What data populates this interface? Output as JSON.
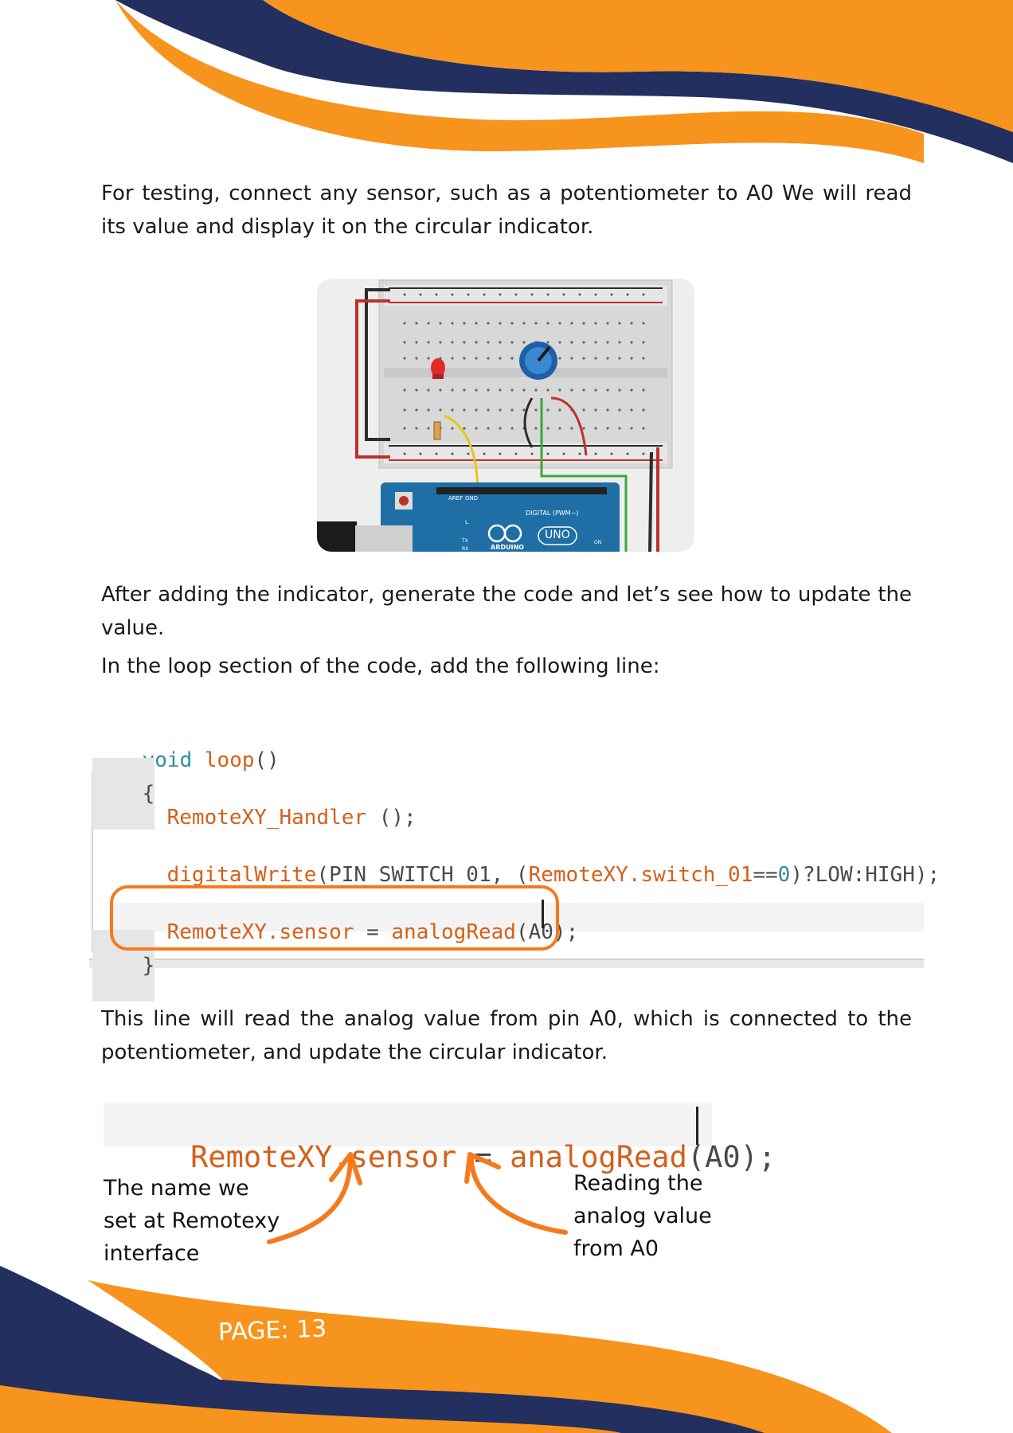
{
  "paragraphs": {
    "p1": "For testing, connect any sensor, such as a potentiometer to A0 We will read its value and display it on the circular indicator.",
    "p2": "After adding the indicator, generate the code and let’s see how to update the value.",
    "p3": "In the loop section of the code, add the following line:",
    "p4": "This line will read the analog value from pin A0, which is connected to the potentiometer, and update the circular indicator."
  },
  "circuit": {
    "board_pin_header": "DIGITAL (PWM~)",
    "board_logo": "UNO",
    "board_brand": "ARDUINO",
    "on_label": "ON",
    "tx_label": "TX",
    "rx_label": "RX",
    "l_label": "L",
    "aref": "AREF",
    "gnd": "GND"
  },
  "code": {
    "kw_void": "void",
    "fn_loop": "loop",
    "parens": "()",
    "brace_open": "{",
    "brace_close": "}",
    "handler_name": "RemoteXY_Handler",
    "handler_rest": " ();",
    "dw_name": "digitalWrite",
    "dw_open": "(PIN_SWITCH_01, (",
    "dw_obj": "RemoteXY",
    "dw_field": ".switch_01",
    "dw_eq": "==",
    "dw_zero": "0",
    "dw_tail": ")?LOW:HIGH);",
    "sensor_obj": "RemoteXY",
    "sensor_field": ".sensor",
    "sensor_eq": " = ",
    "sensor_fn": "analogRead",
    "sensor_args": "(A0);"
  },
  "annotations": {
    "left": [
      "The name we",
      "set at Remotexy",
      "interface"
    ],
    "right": [
      "Reading the",
      "analog value",
      "from A0"
    ]
  },
  "footer": {
    "page_label": "PAGE: 13"
  },
  "colors": {
    "orange": "#F7941D",
    "navy": "#232F5E",
    "code_orange": "#D4601A",
    "code_teal": "#2E8F95"
  }
}
